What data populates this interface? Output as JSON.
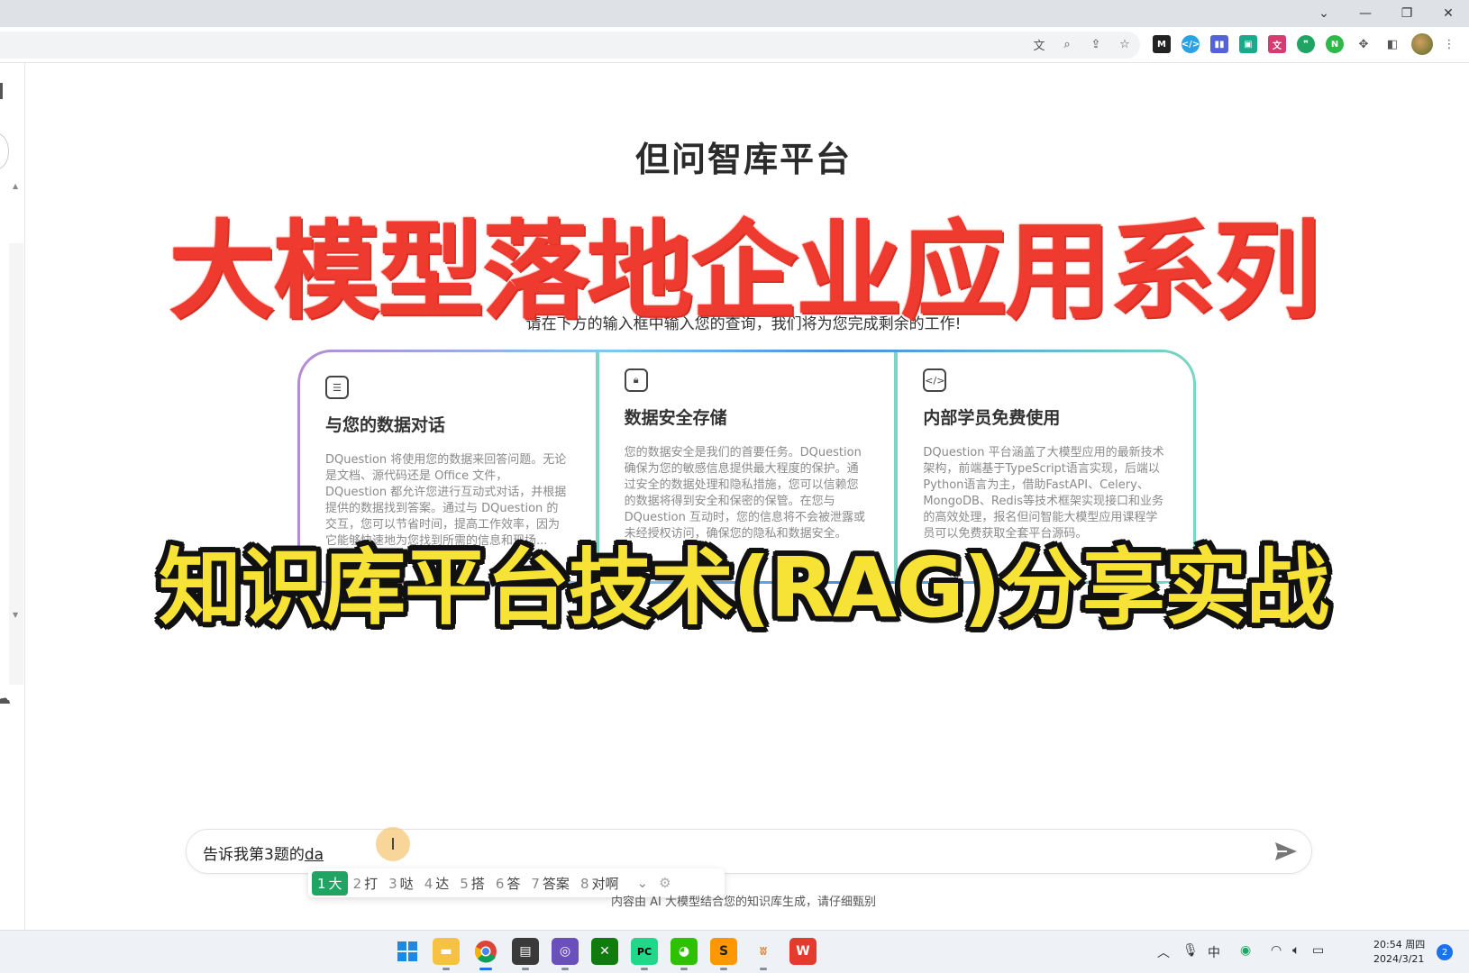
{
  "window": {
    "controls": [
      "chevron-down",
      "minimize",
      "restore",
      "close"
    ]
  },
  "main": {
    "title": "但问智库平台",
    "prompt": "请在下方的输入框中输入您的查询，我们将为您完成剩余的工作!",
    "cards": [
      {
        "icon": "chat-bubble-icon",
        "title": "与您的数据对话",
        "desc": "DQuestion 将使用您的数据来回答问题。无论是文档、源代码还是 Office 文件，DQuestion 都允许您进行互动式对话，并根据提供的数据找到答案。通过与 DQuestion 的交互，您可以节省时间，提高工作效率，因为它能够快速地为您找到所需的信息和现场..."
      },
      {
        "icon": "lock-icon",
        "title": "数据安全存储",
        "desc": "您的数据安全是我们的首要任务。DQuestion 确保为您的敏感信息提供最大程度的保护。通过安全的数据处理和隐私措施，您可以信赖您的数据将得到安全和保密的保管。在您与 DQuestion 互动时，您的信息将不会被泄露或未经授权访问，确保您的隐私和数据安全。"
      },
      {
        "icon": "code-bubble-icon",
        "title": "内部学员免费使用",
        "desc": "DQuestion 平台涵盖了大模型应用的最新技术架构，前端基于TypeScript语言实现，后端以Python语言为主，借助FastAPI、Celery、MongoDB、Redis等技术框架实现接口和业务的高效处理，报名但问智能大模型应用课程学员可以免费获取全套平台源码。"
      }
    ]
  },
  "overlay": {
    "banner_top": "大模型落地企业应用系列",
    "banner_bottom": "知识库平台技术(RAG)分享实战"
  },
  "chat": {
    "input_text": "告诉我第3题的",
    "input_typed": "da",
    "disclaimer": "内容由 AI 大模型结合您的知识库生成，请仔细甄别"
  },
  "ime": {
    "candidates": [
      {
        "num": "1",
        "text": "大"
      },
      {
        "num": "2",
        "text": "打"
      },
      {
        "num": "3",
        "text": "哒"
      },
      {
        "num": "4",
        "text": "达"
      },
      {
        "num": "5",
        "text": "搭"
      },
      {
        "num": "6",
        "text": "答"
      },
      {
        "num": "7",
        "text": "答案"
      },
      {
        "num": "8",
        "text": "对啊"
      }
    ]
  },
  "taskbar": {
    "tray_ime": "中",
    "time": "20:54 周四",
    "date": "2024/3/21",
    "notifications": "2"
  },
  "colors": {
    "banner_red": "#ef3a2f",
    "banner_yellow": "#f7e335",
    "ime_active": "#1fa463",
    "accent": "#1a73e8"
  }
}
